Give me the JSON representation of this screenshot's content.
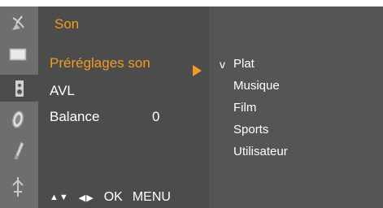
{
  "menu": {
    "title": "Son",
    "items": [
      {
        "label": "Préréglages son",
        "active": true
      },
      {
        "label": "AVL",
        "active": false
      },
      {
        "label": "Balance",
        "active": false
      }
    ],
    "balance_value": "0"
  },
  "submenu": {
    "checkmark": "v",
    "options": [
      "Plat",
      "Musique",
      "Film",
      "Sports",
      "Utilisateur"
    ]
  },
  "nav": {
    "updown": "▲▼",
    "leftright": "◀▶",
    "ok": "OK",
    "menu": "MENU"
  },
  "sidebar_icons": [
    "satellite-dish-icon",
    "screen-icon",
    "speaker-icon",
    "clock-icon",
    "option-tool-icon",
    "input-plug-icon"
  ],
  "colors": {
    "accent": "#f19a24",
    "panel": "#4c4c4c",
    "submenu_panel": "#555555",
    "sidebar": "#6e6e6e"
  }
}
